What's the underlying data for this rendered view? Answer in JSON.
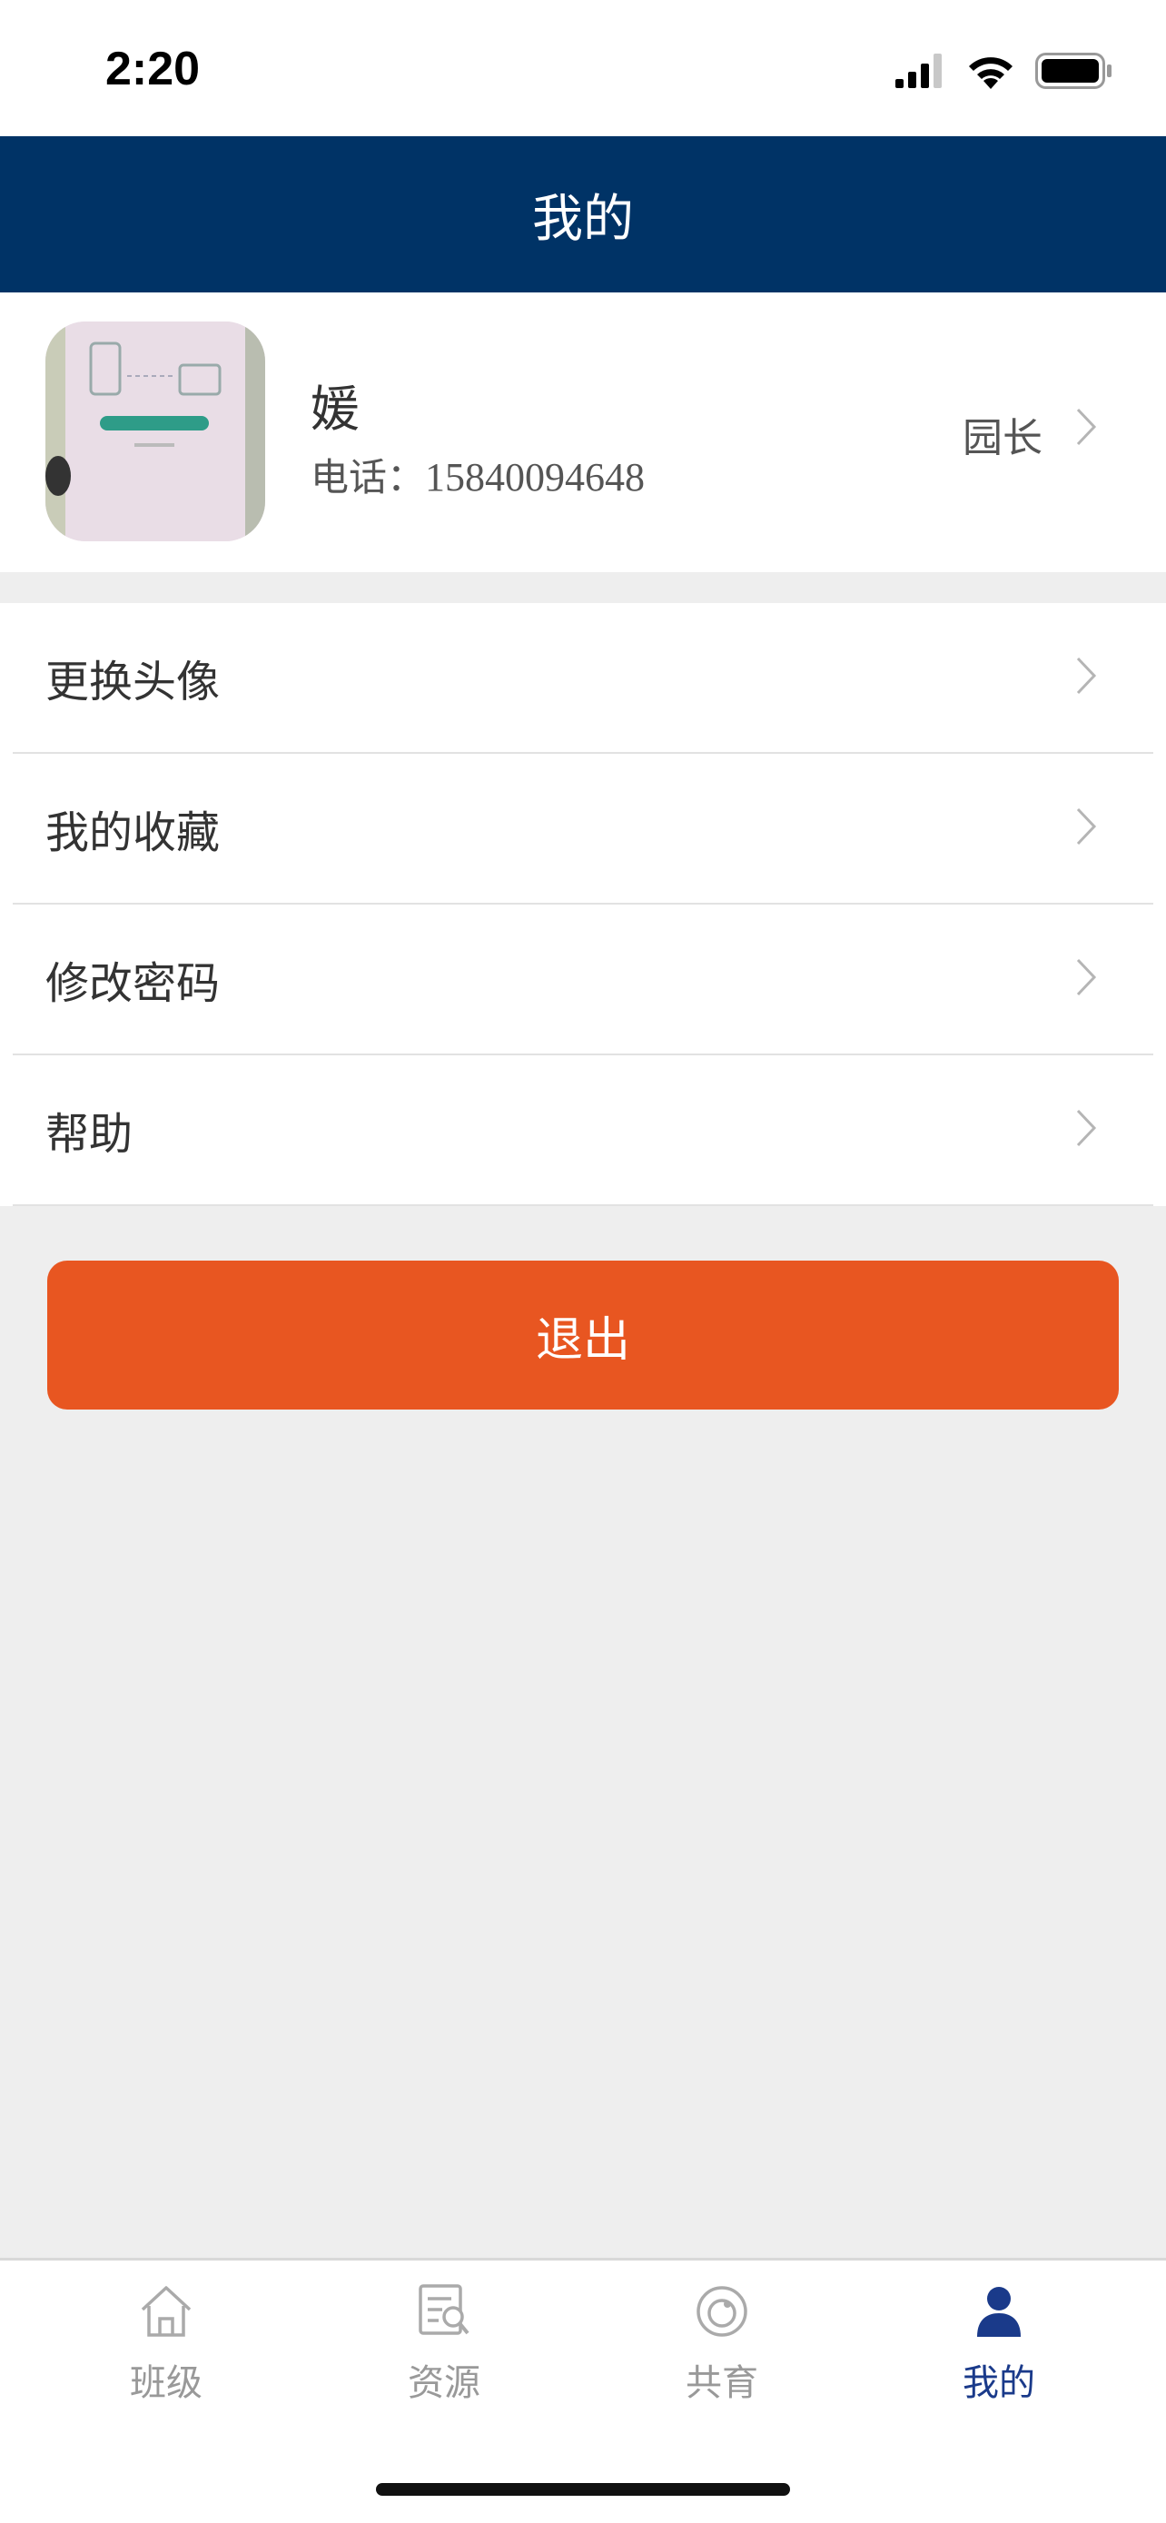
{
  "status_bar": {
    "time": "2:20"
  },
  "header": {
    "title": "我的"
  },
  "profile": {
    "name": "媛",
    "phone_label": "电话：",
    "phone": "15840094648",
    "role": "园长"
  },
  "menu": {
    "items": [
      {
        "label": "更换头像"
      },
      {
        "label": "我的收藏"
      },
      {
        "label": "修改密码"
      },
      {
        "label": "帮助"
      }
    ]
  },
  "logout_label": "退出",
  "tabs": [
    {
      "label": "班级",
      "icon": "home-icon"
    },
    {
      "label": "资源",
      "icon": "resource-search-icon"
    },
    {
      "label": "共育",
      "icon": "co-parenting-icon"
    },
    {
      "label": "我的",
      "icon": "user-icon",
      "active": true
    }
  ],
  "colors": {
    "header": "#003366",
    "logout": "#e85621",
    "active_tab": "#1a3a8a"
  }
}
